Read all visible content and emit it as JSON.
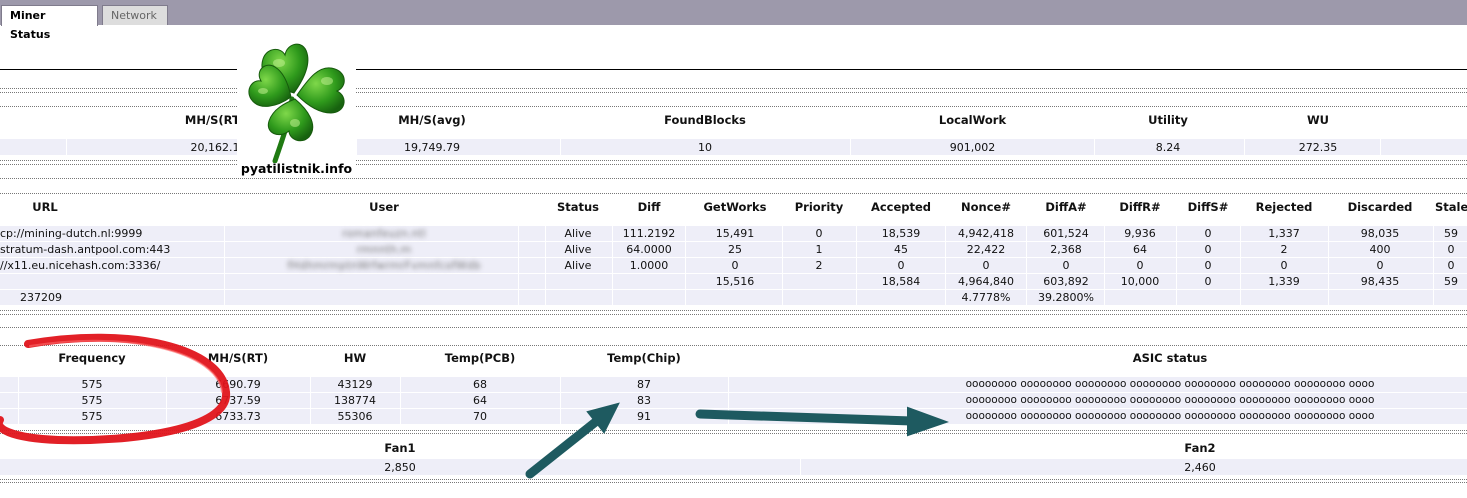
{
  "tabs": [
    {
      "label": "Miner Status"
    },
    {
      "label": "Network"
    }
  ],
  "logo": {
    "text": "pyatilistnik.info"
  },
  "summary": {
    "headers": [
      "MH/S(RT)",
      "MH/S(avg)",
      "FoundBlocks",
      "LocalWork",
      "Utility",
      "WU"
    ],
    "values": [
      "20,162.1",
      "19,749.79",
      "10",
      "901,002",
      "8.24",
      "272.35"
    ]
  },
  "pools": {
    "headers": [
      "URL",
      "User",
      "Status",
      "Diff",
      "GetWorks",
      "Priority",
      "Accepted",
      "Nonce#",
      "DiffA#",
      "DiffR#",
      "DiffS#",
      "Rejected",
      "Discarded",
      "Stale"
    ],
    "rows": [
      [
        "cp://mining-dutch.nl:9999",
        "romanfeuzn.ntl",
        "Alive",
        "111.2192",
        "15,491",
        "0",
        "18,539",
        "4,942,418",
        "601,524",
        "9,936",
        "0",
        "1,337",
        "98,035",
        "59"
      ],
      [
        "stratum-dash.antpool.com:443",
        "rmnnth.m",
        "Alive",
        "64.0000",
        "25",
        "1",
        "45",
        "22,422",
        "2,368",
        "64",
        "0",
        "2",
        "400",
        "0"
      ],
      [
        "//x11.eu.nicehash.com:3336/",
        "fHdhmrmptnWrfwrmrFvmnfcofWdb",
        "Alive",
        "1.0000",
        "0",
        "2",
        "0",
        "0",
        "0",
        "0",
        "0",
        "0",
        "0",
        "0"
      ],
      [
        "",
        "",
        "",
        "",
        "15,516",
        "",
        "18,584",
        "4,964,840",
        "603,892",
        "10,000",
        "0",
        "1,339",
        "98,435",
        "59"
      ],
      [
        "237209",
        "",
        "",
        "",
        "",
        "",
        "",
        "4.7778%",
        "39.2800%",
        "",
        "",
        "",
        "",
        ""
      ]
    ]
  },
  "chains": {
    "headers": [
      "Frequency",
      "MH/S(RT)",
      "HW",
      "Temp(PCB)",
      "Temp(Chip)",
      "ASIC status"
    ],
    "rows": [
      [
        "575",
        "6690.79",
        "43129",
        "68",
        "87",
        "oooooooo oooooooo oooooooo oooooooo oooooooo oooooooo oooooooo oooo"
      ],
      [
        "575",
        "6737.59",
        "138774",
        "64",
        "83",
        "oooooooo oooooooo oooooooo oooooooo oooooooo oooooooo oooooooo oooo"
      ],
      [
        "575",
        "6733.73",
        "55306",
        "70",
        "91",
        "oooooooo oooooooo oooooooo oooooooo oooooooo oooooooo oooooooo oooo"
      ]
    ]
  },
  "fans": {
    "headers": [
      "Fan1",
      "Fan2"
    ],
    "values": [
      "2,850",
      "2,460"
    ]
  },
  "colors": {
    "circle": "#e0141b",
    "arrow": "#1e5a60",
    "stripe": "#eeeef8",
    "tabbar": "#9d99ab"
  },
  "icons": {
    "logo": "four-leaf-clover-icon"
  }
}
